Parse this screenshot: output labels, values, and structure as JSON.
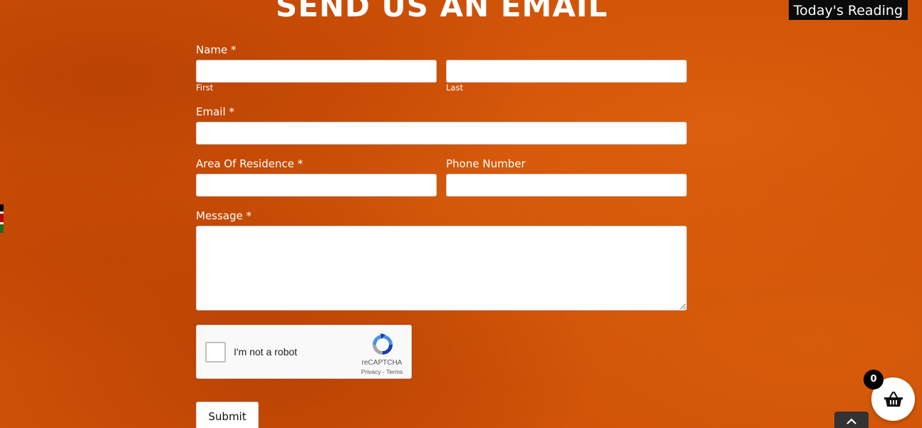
{
  "page": {
    "heading": "SEND US AN EMAIL",
    "today_reading": "Today's Reading"
  },
  "form": {
    "name_label": "Name *",
    "first_sublabel": "First",
    "last_sublabel": "Last",
    "first_value": "",
    "last_value": "",
    "email_label": "Email *",
    "email_value": "",
    "residence_label": "Area Of Residence *",
    "residence_value": "",
    "phone_label": "Phone Number",
    "phone_value": "",
    "message_label": "Message *",
    "message_value": "",
    "submit_label": "Submit"
  },
  "recaptcha": {
    "checkbox_text": "I'm not a robot",
    "brand": "reCAPTCHA",
    "links": "Privacy - Terms",
    "checked": false
  },
  "cart": {
    "count": "0",
    "icon": "basket-icon"
  },
  "scroll_top": {
    "icon": "chevron-up-icon"
  },
  "colors": {
    "background": "#cf5207",
    "text": "#ffffff",
    "badge": "#000000"
  }
}
